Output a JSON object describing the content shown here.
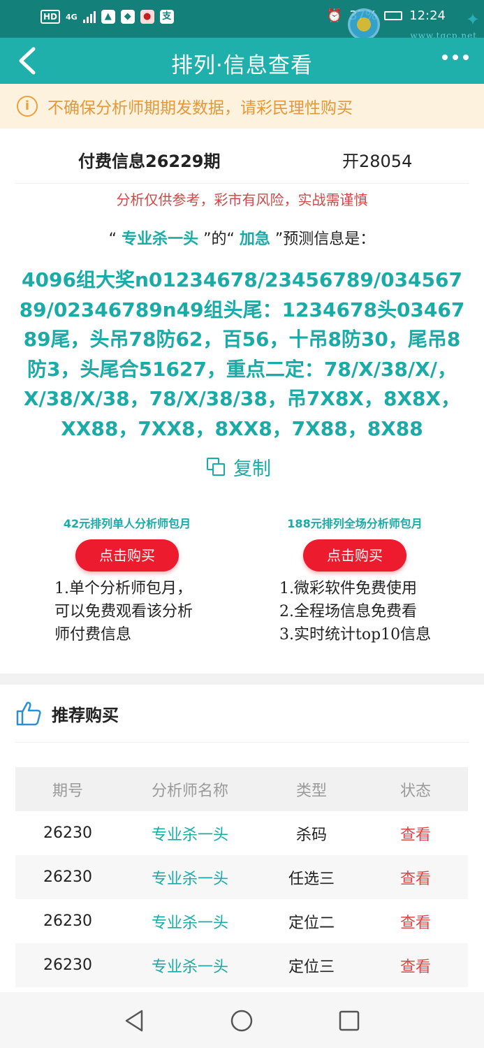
{
  "status_bar": {
    "hd_badge": "HD",
    "network": "4G",
    "battery": "37%",
    "time": "12:24",
    "app_icons": [
      "支"
    ]
  },
  "watermark": {
    "site": "www.tqcp.net"
  },
  "nav": {
    "title": "排列·信息查看"
  },
  "notice": {
    "icon": "i",
    "text": "不确保分析师期期发数据，请彩民理性购买"
  },
  "info": {
    "issue_title": "付费信息26229期",
    "open_result": "开28054",
    "risk_note": "分析仅供参考，彩市有风险，实战需谨慎",
    "predict_prefix": "“",
    "analyst": "专业杀一头",
    "predict_mid": "”的“",
    "tag": "加急",
    "predict_suffix": "”预测信息是：",
    "content": "4096组大奖n01234678/23456789/03456789/02346789n49组头尾：1234678头0346789尾，头吊78防62，百56，十吊8防30，尾吊8防3，头尾合51627，重点二定：78/X/38/X/，X/38/X/38，78/X/38/38，吊7X8X，8X8X，XX88，7XX8，8XX8，7X88，8X88",
    "copy_label": "复制"
  },
  "plans": [
    {
      "title": "42元排列单人分析师包月",
      "button": "点击购买",
      "desc": [
        "1.单个分析师包月，",
        "可以免费观看该分析",
        "师付费信息"
      ]
    },
    {
      "title": "188元排列全场分析师包月",
      "button": "点击购买",
      "desc": [
        "1.微彩软件免费使用",
        "2.全程场信息免费看",
        "3.实时统计top10信息"
      ]
    }
  ],
  "recommend": {
    "title": "推荐购买",
    "columns": [
      "期号",
      "分析师名称",
      "类型",
      "状态"
    ],
    "rows": [
      [
        "26230",
        "专业杀一头",
        "杀码",
        "查看"
      ],
      [
        "26230",
        "专业杀一头",
        "任选三",
        "查看"
      ],
      [
        "26230",
        "专业杀一头",
        "定位二",
        "查看"
      ],
      [
        "26230",
        "专业杀一头",
        "定位三",
        "查看"
      ]
    ]
  },
  "colors": {
    "teal": "#1fb0ab",
    "status_bar": "#13807a",
    "red": "#ec1c2e",
    "notice_bg": "#fdf2dd"
  }
}
